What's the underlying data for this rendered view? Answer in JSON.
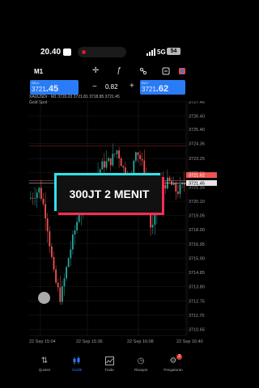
{
  "status": {
    "time": "20.40",
    "network": "5G",
    "battery": "54"
  },
  "toolbar": {
    "timeframe": "M1"
  },
  "trade": {
    "sell_label": "SELL",
    "sell_price_main": "3721",
    "sell_price_big": ".45",
    "lot": "0.82",
    "buy_label": "BUY",
    "buy_price_main": "3721",
    "buy_price_big": ".62"
  },
  "chart_info": {
    "line1": "XAUUSDr · M1  3720.03 3721.81 3718.85 3721.45",
    "line2": "Gold Spot"
  },
  "overlay_text": "300JT 2 MENIT",
  "chart_data": {
    "type": "candlestick",
    "symbol": "XAUUSDr",
    "timeframe": "M1",
    "ylim": [
      3710.2,
      3727.5
    ],
    "y_ticks": [
      "3727.45",
      "3726.40",
      "3725.40",
      "3724.36",
      "3723.25",
      "3722.20",
      "3721.15",
      "3720.10",
      "3719.05",
      "3718.00",
      "3716.95",
      "3715.90",
      "3714.85",
      "3713.80",
      "3712.75",
      "3711.70",
      "3710.65"
    ],
    "x_ticks": [
      "22 Sep 15:04",
      "22 Sep 15:36",
      "22 Sep 16:08",
      "22 Sep 16:40"
    ],
    "bid_price": "3721.45",
    "ask_price": "3721.62",
    "colors": {
      "up": "#26a69a",
      "down": "#ef5350",
      "grid": "#1e1e1e",
      "bid": "#d6d6d6",
      "ask": "#ef5350"
    }
  },
  "tabs": [
    {
      "label": "Quotes",
      "icon": "updown-arrows-icon"
    },
    {
      "label": "Grafik",
      "icon": "chart-icon"
    },
    {
      "label": "Trade",
      "icon": "trend-icon"
    },
    {
      "label": "Riwayat",
      "icon": "clock-icon"
    },
    {
      "label": "Pengaturan",
      "icon": "gears-icon",
      "badge": "2"
    }
  ]
}
